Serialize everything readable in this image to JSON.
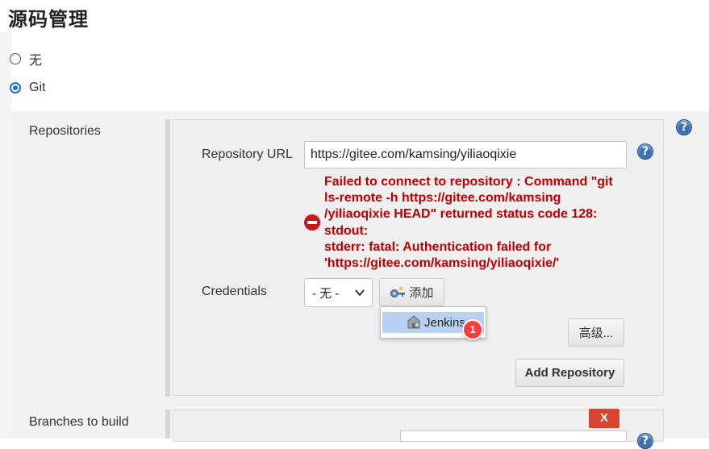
{
  "section": {
    "title": "源码管理"
  },
  "scm_options": [
    {
      "label": "无",
      "checked": false
    },
    {
      "label": "Git",
      "checked": true
    }
  ],
  "repositories": {
    "label": "Repositories",
    "url_label": "Repository URL",
    "url_value": "https://gitee.com/kamsing/yiliaoqixie",
    "error_message": "Failed to connect to repository : Command \"git\nls-remote -h https://gitee.com/kamsing\n/yiliaoqixie HEAD\" returned status code 128:\nstdout:\nstderr: fatal: Authentication failed for\n'https://gitee.com/kamsing/yiliaoqixie/'",
    "credentials_label": "Credentials",
    "credentials_selected": "- 无 -",
    "add_button": "添加",
    "add_menu_items": [
      "Jenkins"
    ],
    "badge_number": "1",
    "advanced_button": "高级...",
    "add_repository_button": "Add Repository"
  },
  "branches": {
    "label": "Branches to build",
    "delete_button": "X"
  },
  "help_icon_glyph": "?",
  "colors": {
    "error": "#c00000",
    "radio_accent": "#1c6fd6",
    "highlight": "#b8d0f2",
    "delete": "#d9432f",
    "badge": "#ff3b3b"
  }
}
